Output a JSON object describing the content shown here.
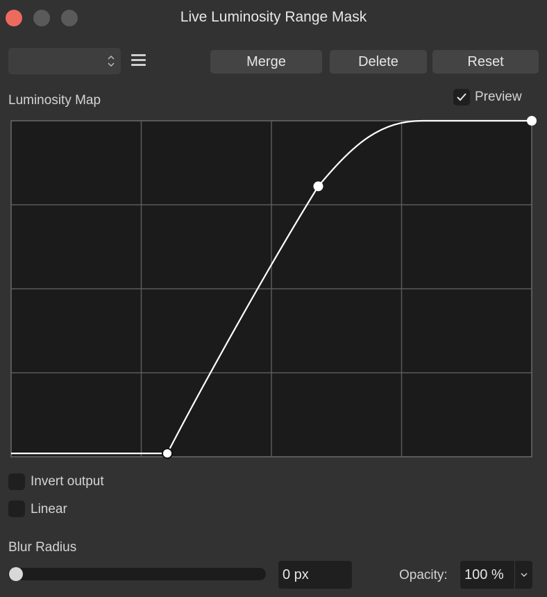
{
  "window": {
    "title": "Live Luminosity Range Mask"
  },
  "toolbar": {
    "preset_value": "",
    "merge_label": "Merge",
    "delete_label": "Delete",
    "reset_label": "Reset"
  },
  "luminosity_map": {
    "label": "Luminosity Map",
    "preview_label": "Preview",
    "preview_checked": true
  },
  "options": {
    "invert_label": "Invert output",
    "invert_checked": false,
    "linear_label": "Linear",
    "linear_checked": false
  },
  "blur": {
    "label": "Blur Radius",
    "value": "0 px",
    "slider_fraction": 0
  },
  "opacity": {
    "label": "Opacity:",
    "value": "100 %"
  },
  "colors": {
    "close_button": "#ed6a5e",
    "curve": "#ffffff",
    "graph_background": "#1b1b1b",
    "grid": "#5a5a5a"
  },
  "chart_data": {
    "type": "line",
    "x_range": [
      0,
      1
    ],
    "y_range": [
      0,
      1
    ],
    "grid": true,
    "control_points": [
      {
        "x": 0.3,
        "y": 0.01
      },
      {
        "x": 0.59,
        "y": 0.805
      },
      {
        "x": 1.0,
        "y": 1.0
      }
    ]
  }
}
